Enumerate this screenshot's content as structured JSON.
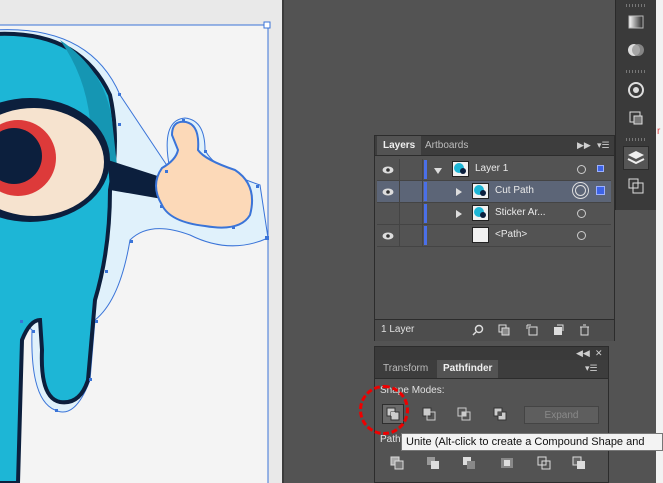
{
  "layers_panel": {
    "tabs": [
      "Layers",
      "Artboards"
    ],
    "layers": [
      {
        "name": "Layer 1",
        "expanded": true,
        "selected": false
      },
      {
        "name": "Cut Path",
        "expanded": false,
        "selected": true
      },
      {
        "name": "Sticker Ar...",
        "expanded": false,
        "selected": false
      },
      {
        "name": "<Path>",
        "expanded": false,
        "selected": false
      }
    ],
    "footer_count": "1 Layer"
  },
  "pathfinder_panel": {
    "tabs": [
      "Transform",
      "Pathfinder"
    ],
    "shape_modes_label": "Shape Modes:",
    "pathfinders_label": "Pathf",
    "expand_label": "Expand"
  },
  "tooltip": "Unite (Alt-click to create a Compound Shape and",
  "icons": {
    "eye": "eye-icon",
    "expand": "triangle-expand-icon",
    "collapse": "triangle-collapse-icon",
    "search": "search-icon",
    "trash": "trash-icon",
    "new_layer": "new-layer-icon",
    "menu": "panel-menu-icon"
  },
  "colors": {
    "layer_color": "#4a6fe8",
    "selection": "#3d63e6",
    "highlight_ring": "#e00000",
    "tooltip_bg": "#f3f3f3"
  }
}
